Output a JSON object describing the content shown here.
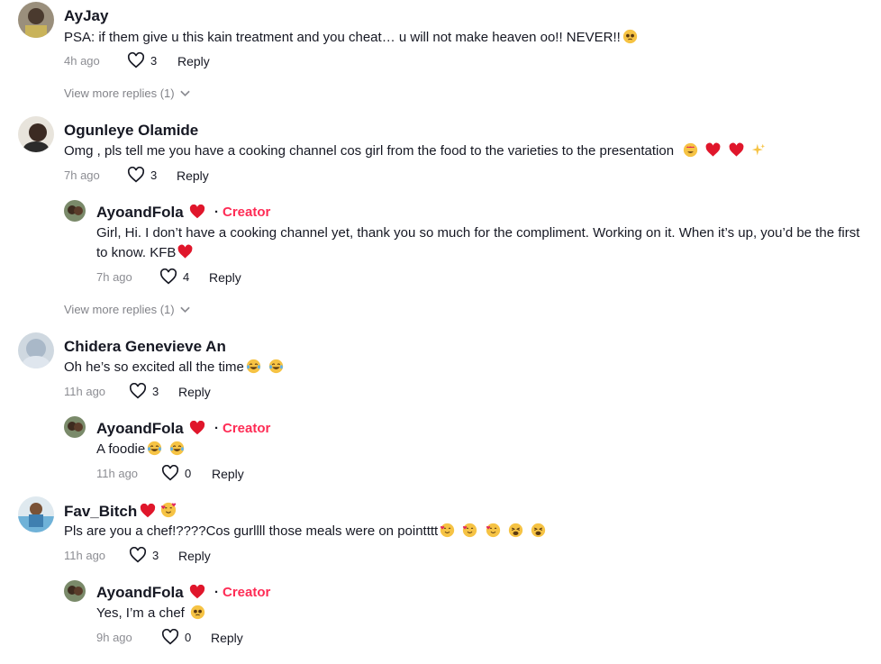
{
  "colors": {
    "accent": "#fe2c55",
    "text": "#161823",
    "muted": "rgba(22,24,35,0.5)"
  },
  "comments": [
    {
      "user": "AyJay",
      "text": "PSA: if them give u this kain treatment and you cheat… u will not make heaven oo!! NEVER!!",
      "time": "4h ago",
      "likes": "3",
      "reply_label": "Reply",
      "view_more": "View more replies (1)"
    },
    {
      "user": "Ogunleye Olamide",
      "text": "Omg , pls tell me you have a cooking channel cos girl from the food to the varieties to the presentation",
      "time": "7h ago",
      "likes": "3",
      "reply_label": "Reply",
      "view_more": "View more replies (1)",
      "reply": {
        "user": "AyoandFola",
        "creator": "Creator",
        "text": "Girl, Hi. I don’t have a cooking channel yet, thank you so much for the compliment. Working on it. When it’s up, you’d be the first to know. KFB",
        "time": "7h ago",
        "likes": "4",
        "reply_label": "Reply"
      }
    },
    {
      "user": "Chidera Genevieve An",
      "text": "Oh he’s so excited all the time",
      "time": "11h ago",
      "likes": "3",
      "reply_label": "Reply",
      "reply": {
        "user": "AyoandFola",
        "creator": "Creator",
        "text": "A foodie",
        "time": "11h ago",
        "likes": "0",
        "reply_label": "Reply"
      }
    },
    {
      "user": "Fav_Bitch",
      "text": "Pls are you a chef!????Cos gurllll those meals were on pointttt",
      "time": "11h ago",
      "likes": "3",
      "reply_label": "Reply",
      "reply": {
        "user": "AyoandFola",
        "creator": "Creator",
        "text": "Yes, I’m a chef",
        "time": "9h ago",
        "likes": "0",
        "reply_label": "Reply"
      }
    }
  ]
}
